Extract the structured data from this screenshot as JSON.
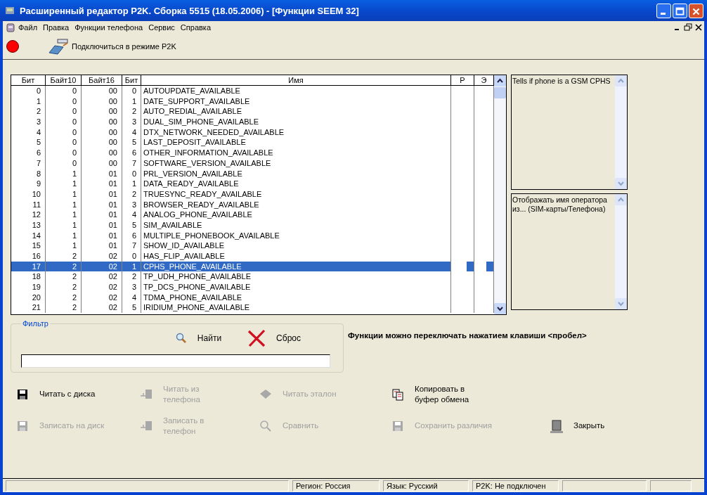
{
  "window": {
    "title": "Расширенный редактор P2K. Сборка 5515 (18.05.2006) - [Функции SEEM 32]"
  },
  "menu": [
    "Файл",
    "Правка",
    "Функции телефона",
    "Сервис",
    "Справка"
  ],
  "toolbar": {
    "connected": false,
    "connect_label": "Подключиться в режиме P2K"
  },
  "table": {
    "columns": [
      "Бит",
      "Байт10",
      "Байт16",
      "Бит",
      "Имя",
      "Р",
      "Э"
    ],
    "rows": [
      {
        "cells": [
          "0",
          "0",
          "00",
          "0",
          "AUTOUPDATE_AVAILABLE"
        ],
        "selected": false
      },
      {
        "cells": [
          "1",
          "0",
          "00",
          "1",
          "DATE_SUPPORT_AVAILABLE"
        ],
        "selected": false
      },
      {
        "cells": [
          "2",
          "0",
          "00",
          "2",
          "AUTO_REDIAL_AVAILABLE"
        ],
        "selected": false
      },
      {
        "cells": [
          "3",
          "0",
          "00",
          "3",
          "DUAL_SIM_PHONE_AVAILABLE"
        ],
        "selected": false
      },
      {
        "cells": [
          "4",
          "0",
          "00",
          "4",
          "DTX_NETWORK_NEEDED_AVAILABLE"
        ],
        "selected": false
      },
      {
        "cells": [
          "5",
          "0",
          "00",
          "5",
          "LAST_DEPOSIT_AVAILABLE"
        ],
        "selected": false
      },
      {
        "cells": [
          "6",
          "0",
          "00",
          "6",
          "OTHER_INFORMATION_AVAILABLE"
        ],
        "selected": false
      },
      {
        "cells": [
          "7",
          "0",
          "00",
          "7",
          "SOFTWARE_VERSION_AVAILABLE"
        ],
        "selected": false
      },
      {
        "cells": [
          "8",
          "1",
          "01",
          "0",
          "PRL_VERSION_AVAILABLE"
        ],
        "selected": false
      },
      {
        "cells": [
          "9",
          "1",
          "01",
          "1",
          "DATA_READY_AVAILABLE"
        ],
        "selected": false
      },
      {
        "cells": [
          "10",
          "1",
          "01",
          "2",
          "TRUESYNC_READY_AVAILABLE"
        ],
        "selected": false
      },
      {
        "cells": [
          "11",
          "1",
          "01",
          "3",
          "BROWSER_READY_AVAILABLE"
        ],
        "selected": false
      },
      {
        "cells": [
          "12",
          "1",
          "01",
          "4",
          "ANALOG_PHONE_AVAILABLE"
        ],
        "selected": false
      },
      {
        "cells": [
          "13",
          "1",
          "01",
          "5",
          "SIM_AVAILABLE"
        ],
        "selected": false
      },
      {
        "cells": [
          "14",
          "1",
          "01",
          "6",
          "MULTIPLE_PHONEBOOK_AVAILABLE"
        ],
        "selected": false
      },
      {
        "cells": [
          "15",
          "1",
          "01",
          "7",
          "SHOW_ID_AVAILABLE"
        ],
        "selected": false
      },
      {
        "cells": [
          "16",
          "2",
          "02",
          "0",
          "HAS_FLIP_AVAILABLE"
        ],
        "selected": false
      },
      {
        "cells": [
          "17",
          "2",
          "02",
          "1",
          "CPHS_PHONE_AVAILABLE"
        ],
        "selected": true
      },
      {
        "cells": [
          "18",
          "2",
          "02",
          "2",
          "TP_UDH_PHONE_AVAILABLE"
        ],
        "selected": false
      },
      {
        "cells": [
          "19",
          "2",
          "02",
          "3",
          "TP_DCS_PHONE_AVAILABLE"
        ],
        "selected": false
      },
      {
        "cells": [
          "20",
          "2",
          "02",
          "4",
          "TDMA_PHONE_AVAILABLE"
        ],
        "selected": false
      },
      {
        "cells": [
          "21",
          "2",
          "02",
          "5",
          "IRIDIUM_PHONE_AVAILABLE"
        ],
        "selected": false
      }
    ]
  },
  "descriptions": [
    "Tells if phone is a GSM CPHS",
    "Отображать имя оператора из... (SIM-карты/Телефона)"
  ],
  "filter": {
    "title": "Фильтр",
    "find": "Найти",
    "reset": "Сброс"
  },
  "hint": "Функции можно переключать нажатием клавиши <пробел>",
  "actions": [
    {
      "label": "Читать с диска",
      "kind": "read-disk",
      "disabled": false
    },
    {
      "label": "Читать из телефона",
      "kind": "read-phone",
      "disabled": true
    },
    {
      "label": "Читать эталон",
      "kind": "read-reference",
      "disabled": true
    },
    {
      "label": "Копировать в буфер обмена",
      "kind": "copy",
      "disabled": false
    },
    {
      "label": "Записать на диск",
      "kind": "write-disk",
      "disabled": true
    },
    {
      "label": "Записать в телефон",
      "kind": "write-phone",
      "disabled": true
    },
    {
      "label": "Сравнить",
      "kind": "compare",
      "disabled": true
    },
    {
      "label": "Сохранить различия",
      "kind": "save-diff",
      "disabled": true
    },
    {
      "label": "Закрыть",
      "kind": "close",
      "disabled": false
    }
  ],
  "status_bar": [
    "Регион: Россия",
    "Язык: Русский",
    "P2K: Не подключен"
  ]
}
